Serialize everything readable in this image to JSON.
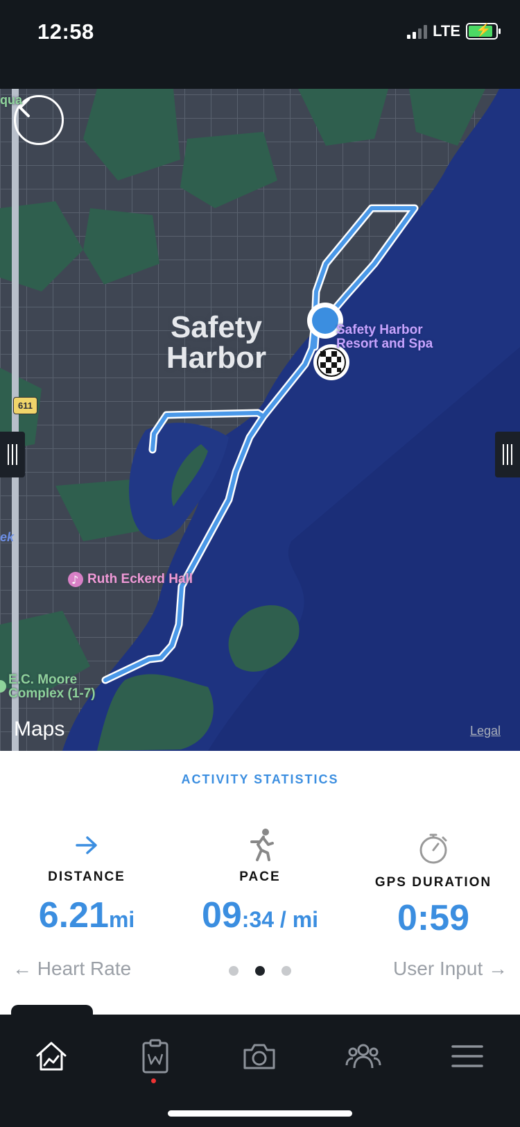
{
  "status_bar": {
    "time": "12:58",
    "network": "LTE"
  },
  "map": {
    "town_label_line1": "Safety",
    "town_label_line2": "Harbor",
    "poi_resort_line1": "Safety Harbor",
    "poi_resort_line2": "Resort and Spa",
    "poi_hall": "Ruth Eckerd Hall",
    "poi_complex_line1": "E.C. Moore",
    "poi_complex_line2": "Complex (1-7)",
    "road_badge": "611",
    "edge_text_top": "qua",
    "edge_text_creek": "ek",
    "maps_logo": "Maps",
    "legal": "Legal",
    "icons": [
      "back-chevron-icon",
      "current-location-icon",
      "finish-flag-icon",
      "music-note-icon"
    ]
  },
  "stats": {
    "title": "ACTIVITY STATISTICS",
    "distance": {
      "label": "DISTANCE",
      "value": "6.21",
      "unit": "mi",
      "icon": "arrow-right-icon"
    },
    "pace": {
      "label": "PACE",
      "value_main": "09",
      "value_rest": ":34 / mi",
      "icon": "runner-icon"
    },
    "gps_duration": {
      "label": "GPS DURATION",
      "value": "0:59",
      "icon": "stopwatch-icon"
    },
    "pager": {
      "prev": "← Heart Rate",
      "next": "User Input →",
      "pages": 3,
      "active": 2
    }
  },
  "tab_bar": {
    "tabs": [
      "home-chart-icon",
      "workout-clipboard-icon",
      "camera-icon",
      "community-icon",
      "menu-icon"
    ],
    "colors": {
      "accent": "#3b8ee0",
      "route": "#4a98e8",
      "bar": "#14181d"
    }
  }
}
